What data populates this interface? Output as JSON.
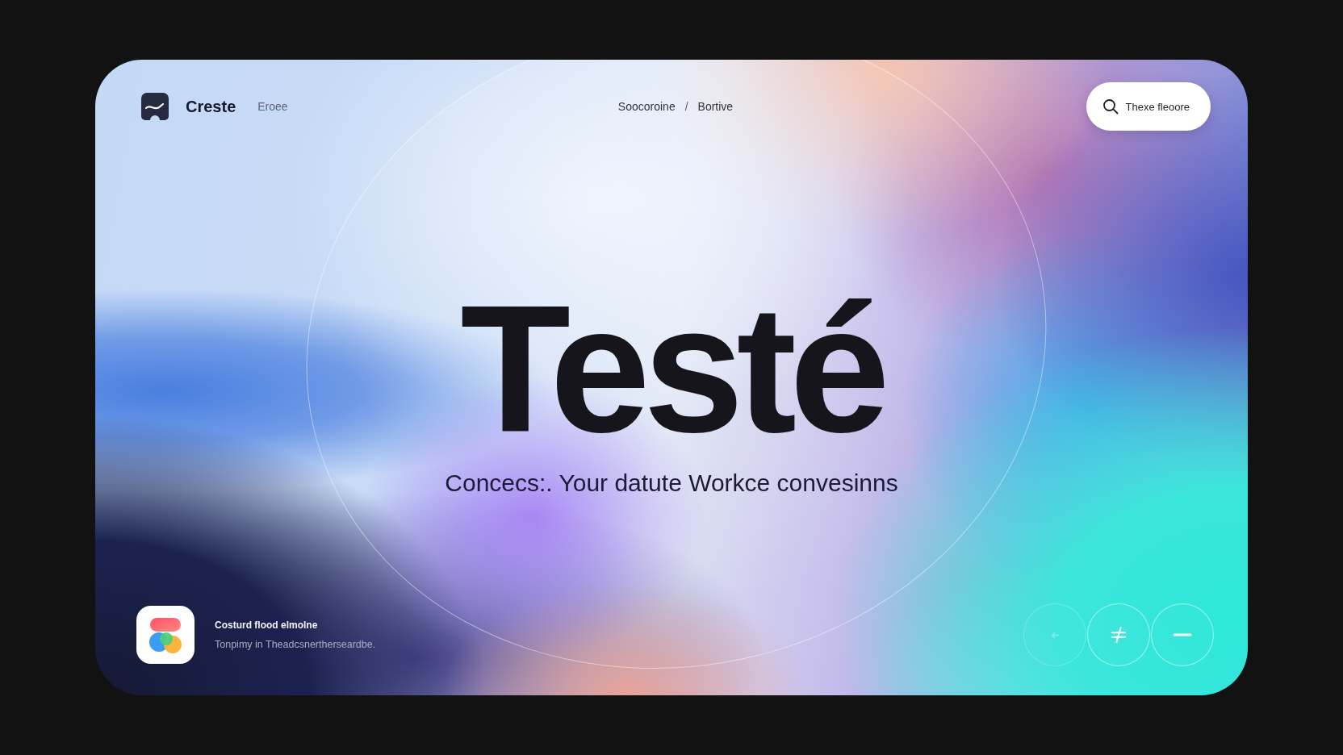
{
  "header": {
    "brand": "Creste",
    "secondary_link": "Eroee",
    "breadcrumb": [
      "Soocoroine",
      "Bortive"
    ],
    "breadcrumb_separator": "/",
    "search_button": {
      "label": "Thexe fleoore"
    }
  },
  "hero": {
    "title": "Testé",
    "subtitle": "Concecs:. Your datute Workce convesinns"
  },
  "footer": {
    "app_card": {
      "title": "Costurd flood elmolne",
      "caption": "Tonpimy in Theadcsnertherseardbe."
    },
    "round_buttons": [
      {
        "kind": "arrow",
        "disabled": true
      },
      {
        "kind": "slash",
        "disabled": false
      },
      {
        "kind": "minus",
        "disabled": false
      }
    ]
  }
}
